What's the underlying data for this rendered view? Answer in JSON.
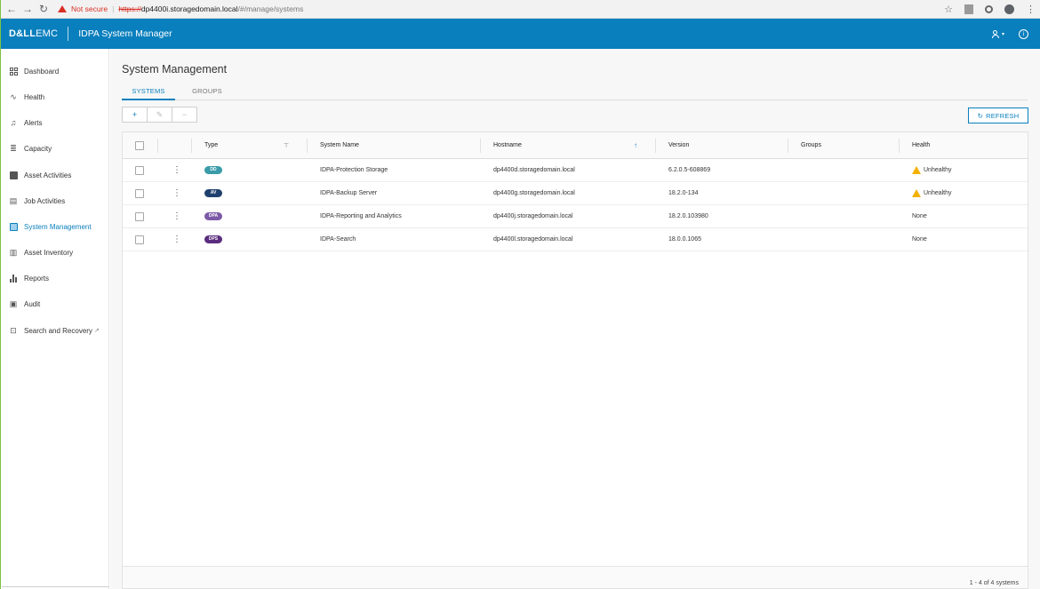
{
  "browser": {
    "security_label": "Not secure",
    "url_scheme": "https://",
    "url_host": "dp4400i.storagedomain.local",
    "url_path": "/#/manage/systems"
  },
  "header": {
    "brand_bold": "D&LL",
    "brand_light": "EMC",
    "app_title": "IDPA System Manager"
  },
  "sidebar": {
    "items": [
      {
        "label": "Dashboard",
        "icon": "dashboard-grid-icon"
      },
      {
        "label": "Health",
        "icon": "pulse-icon"
      },
      {
        "label": "Alerts",
        "icon": "bell-icon"
      },
      {
        "label": "Capacity",
        "icon": "database-icon"
      },
      {
        "label": "Asset Activities",
        "icon": "asset-activities-icon"
      },
      {
        "label": "Job Activities",
        "icon": "job-activities-icon"
      },
      {
        "label": "System Management",
        "icon": "system-management-icon"
      },
      {
        "label": "Asset Inventory",
        "icon": "asset-inventory-icon"
      },
      {
        "label": "Reports",
        "icon": "bar-chart-icon"
      },
      {
        "label": "Audit",
        "icon": "audit-icon"
      },
      {
        "label": "Search and Recovery",
        "icon": "search-recovery-icon"
      }
    ],
    "active_index": 6
  },
  "main": {
    "page_title": "System Management",
    "tabs": [
      {
        "label": "SYSTEMS"
      },
      {
        "label": "GROUPS"
      }
    ],
    "active_tab": 0,
    "toolbar": {
      "add": "+",
      "edit": "✎",
      "delete": "−"
    },
    "refresh_label": "REFRESH"
  },
  "table": {
    "headers": {
      "type": "Type",
      "system_name": "System Name",
      "hostname": "Hostname",
      "version": "Version",
      "groups": "Groups",
      "health": "Health"
    },
    "rows": [
      {
        "type": "DD",
        "type_color": "#3a9ca8",
        "system_name": "IDPA-Protection Storage",
        "hostname": "dp4400d.storagedomain.local",
        "version": "6.2.0.5-608869",
        "groups": "",
        "health": "Unhealthy",
        "health_warn": true
      },
      {
        "type": "AV",
        "type_color": "#1f3f6e",
        "system_name": "IDPA-Backup Server",
        "hostname": "dp4400g.storagedomain.local",
        "version": "18.2.0-134",
        "groups": "",
        "health": "Unhealthy",
        "health_warn": true
      },
      {
        "type": "DPA",
        "type_color": "#7b5aa6",
        "system_name": "IDPA-Reporting and Analytics",
        "hostname": "dp4400j.storagedomain.local",
        "version": "18.2.0.103980",
        "groups": "",
        "health": "None",
        "health_warn": false
      },
      {
        "type": "DPS",
        "type_color": "#5b2d7e",
        "system_name": "IDPA-Search",
        "hostname": "dp4400l.storagedomain.local",
        "version": "18.0.0.1065",
        "groups": "",
        "health": "None",
        "health_warn": false
      }
    ],
    "pager": "1 - 4 of 4 systems"
  },
  "colors": {
    "accent": "#0a7fbd",
    "warning": "#f2b100"
  }
}
